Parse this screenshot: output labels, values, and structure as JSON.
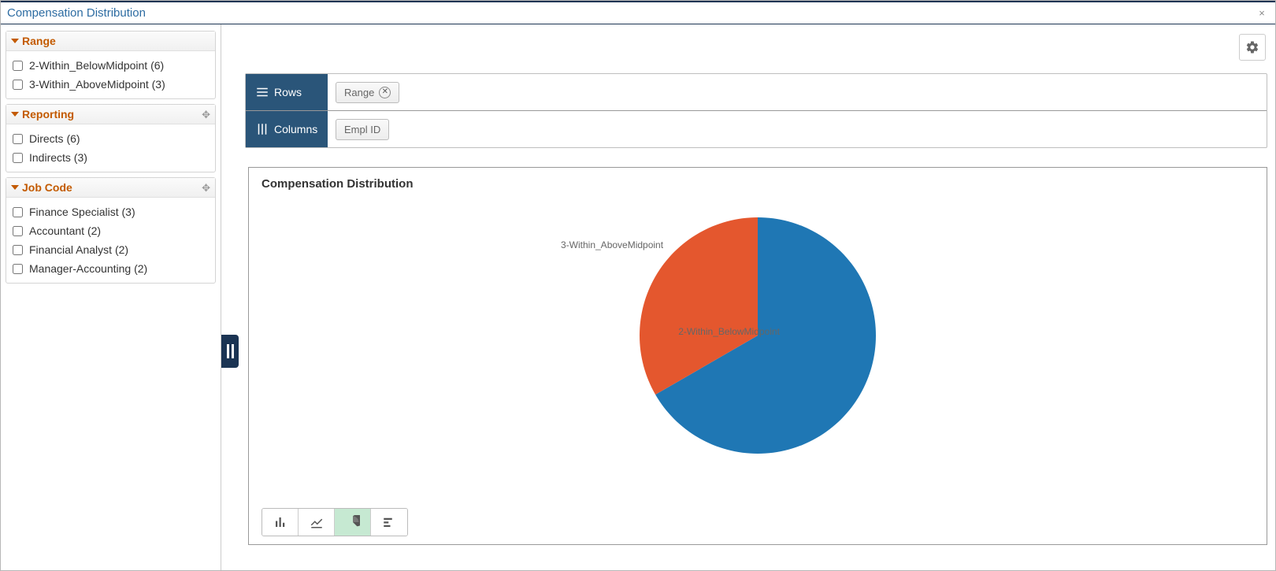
{
  "window": {
    "title": "Compensation Distribution"
  },
  "sidebar": {
    "facets": [
      {
        "title": "Range",
        "show_move": false,
        "items": [
          {
            "label": "2-Within_BelowMidpoint (6)"
          },
          {
            "label": "3-Within_AboveMidpoint (3)"
          }
        ]
      },
      {
        "title": "Reporting",
        "show_move": true,
        "items": [
          {
            "label": "Directs (6)"
          },
          {
            "label": "Indirects (3)"
          }
        ]
      },
      {
        "title": "Job Code",
        "show_move": true,
        "items": [
          {
            "label": "Finance Specialist (3)"
          },
          {
            "label": "Accountant (2)"
          },
          {
            "label": "Financial Analyst (2)"
          },
          {
            "label": "Manager-Accounting (2)"
          }
        ]
      }
    ]
  },
  "shelves": {
    "rows": {
      "label": "Rows",
      "pill": "Range"
    },
    "columns": {
      "label": "Columns",
      "pill": "Empl ID"
    }
  },
  "chart": {
    "title": "Compensation Distribution"
  },
  "chart_data": {
    "type": "pie",
    "title": "Compensation Distribution",
    "series": [
      {
        "name": "2-Within_BelowMidpoint",
        "value": 6,
        "color": "#1f77b4"
      },
      {
        "name": "3-Within_AboveMidpoint",
        "value": 3,
        "color": "#e4572e"
      }
    ]
  }
}
